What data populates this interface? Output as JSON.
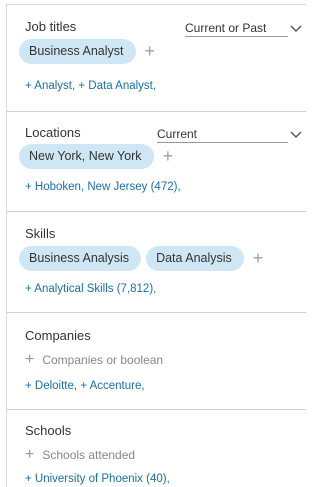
{
  "job_titles": {
    "title": "Job titles",
    "filter": "Current or Past",
    "chips": [
      "Business Analyst"
    ],
    "suggestions": [
      "+ Analyst,",
      "+ Data Analyst,"
    ]
  },
  "locations": {
    "title": "Locations",
    "filter": "Current",
    "chips": [
      "New York, New York"
    ],
    "suggestions": [
      "+ Hoboken, New Jersey (472),"
    ]
  },
  "skills": {
    "title": "Skills",
    "chips": [
      "Business Analysis",
      "Data Analysis"
    ],
    "suggestions": [
      "+ Analytical Skills (7,812),"
    ]
  },
  "companies": {
    "title": "Companies",
    "placeholder": "Companies or boolean",
    "suggestions": [
      "+ Deloitte,",
      "+ Accenture,"
    ]
  },
  "schools": {
    "title": "Schools",
    "placeholder": "Schools attended",
    "suggestions": [
      "+ University of Phoenix (40),"
    ]
  },
  "colors": {
    "chip_bg": "#cfe7f5",
    "link": "#1b6fa8",
    "divider": "#d0d3d6"
  }
}
